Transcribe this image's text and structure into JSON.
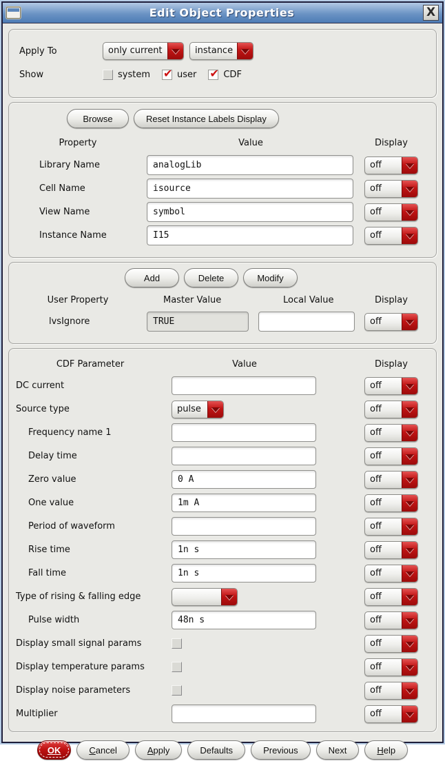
{
  "colors": {
    "accent_red": "#c01414",
    "titlebar_blue": "#4d7cb5"
  },
  "window": {
    "title": "Edit Object Properties",
    "close_label": "X"
  },
  "apply_section": {
    "apply_to_label": "Apply To",
    "scope_value": "only current",
    "target_value": "instance",
    "show_label": "Show",
    "checkboxes": [
      {
        "label": "system",
        "checked": false
      },
      {
        "label": "user",
        "checked": true
      },
      {
        "label": "CDF",
        "checked": true
      }
    ]
  },
  "instance_section": {
    "browse_label": "Browse",
    "reset_label": "Reset Instance Labels Display",
    "headers": {
      "property": "Property",
      "value": "Value",
      "display": "Display"
    },
    "rows": [
      {
        "label": "Library Name",
        "value": "analogLib",
        "display": "off"
      },
      {
        "label": "Cell Name",
        "value": "isource",
        "display": "off"
      },
      {
        "label": "View Name",
        "value": "symbol",
        "display": "off"
      },
      {
        "label": "Instance Name",
        "value": "I15",
        "display": "off"
      }
    ]
  },
  "user_props_section": {
    "add_label": "Add",
    "delete_label": "Delete",
    "modify_label": "Modify",
    "headers": {
      "property": "User Property",
      "master": "Master Value",
      "local": "Local Value",
      "display": "Display"
    },
    "rows": [
      {
        "label": "lvsIgnore",
        "master_value": "TRUE",
        "local_value": "",
        "display": "off"
      }
    ]
  },
  "cdf_section": {
    "headers": {
      "parameter": "CDF Parameter",
      "value": "Value",
      "display": "Display"
    },
    "rows": [
      {
        "label": "DC current",
        "type": "input",
        "value": "",
        "display": "off"
      },
      {
        "label": "Source type",
        "type": "combo",
        "value": "pulse",
        "display": "off"
      },
      {
        "label": "Frequency name 1",
        "type": "input",
        "value": "",
        "display": "off"
      },
      {
        "label": "Delay time",
        "type": "input",
        "value": "",
        "display": "off"
      },
      {
        "label": "Zero value",
        "type": "input",
        "value": "0 A",
        "display": "off"
      },
      {
        "label": "One value",
        "type": "input",
        "value": "1m A",
        "display": "off"
      },
      {
        "label": "Period of waveform",
        "type": "input",
        "value": "",
        "display": "off"
      },
      {
        "label": "Rise time",
        "type": "input",
        "value": "1n s",
        "display": "off"
      },
      {
        "label": "Fall time",
        "type": "input",
        "value": "1n s",
        "display": "off"
      },
      {
        "label": "Type of rising & falling edge",
        "type": "combo",
        "value": "",
        "display": "off"
      },
      {
        "label": "Pulse width",
        "type": "input",
        "value": "48n s",
        "display": "off"
      },
      {
        "label": "Display small signal params",
        "type": "checkbox",
        "checked": false,
        "display": "off"
      },
      {
        "label": "Display temperature params",
        "type": "checkbox",
        "checked": false,
        "display": "off"
      },
      {
        "label": "Display noise parameters",
        "type": "checkbox",
        "checked": false,
        "display": "off"
      },
      {
        "label": "Multiplier",
        "type": "input",
        "value": "",
        "display": "off"
      }
    ]
  },
  "footer": {
    "buttons": [
      {
        "pre": "",
        "mn": "OK",
        "post": ""
      },
      {
        "pre": "",
        "mn": "C",
        "post": "ancel"
      },
      {
        "pre": "",
        "mn": "A",
        "post": "pply"
      },
      {
        "pre": "Defaults",
        "mn": "",
        "post": ""
      },
      {
        "pre": "Previous",
        "mn": "",
        "post": ""
      },
      {
        "pre": "Next",
        "mn": "",
        "post": ""
      },
      {
        "pre": "",
        "mn": "H",
        "post": "elp"
      }
    ]
  }
}
